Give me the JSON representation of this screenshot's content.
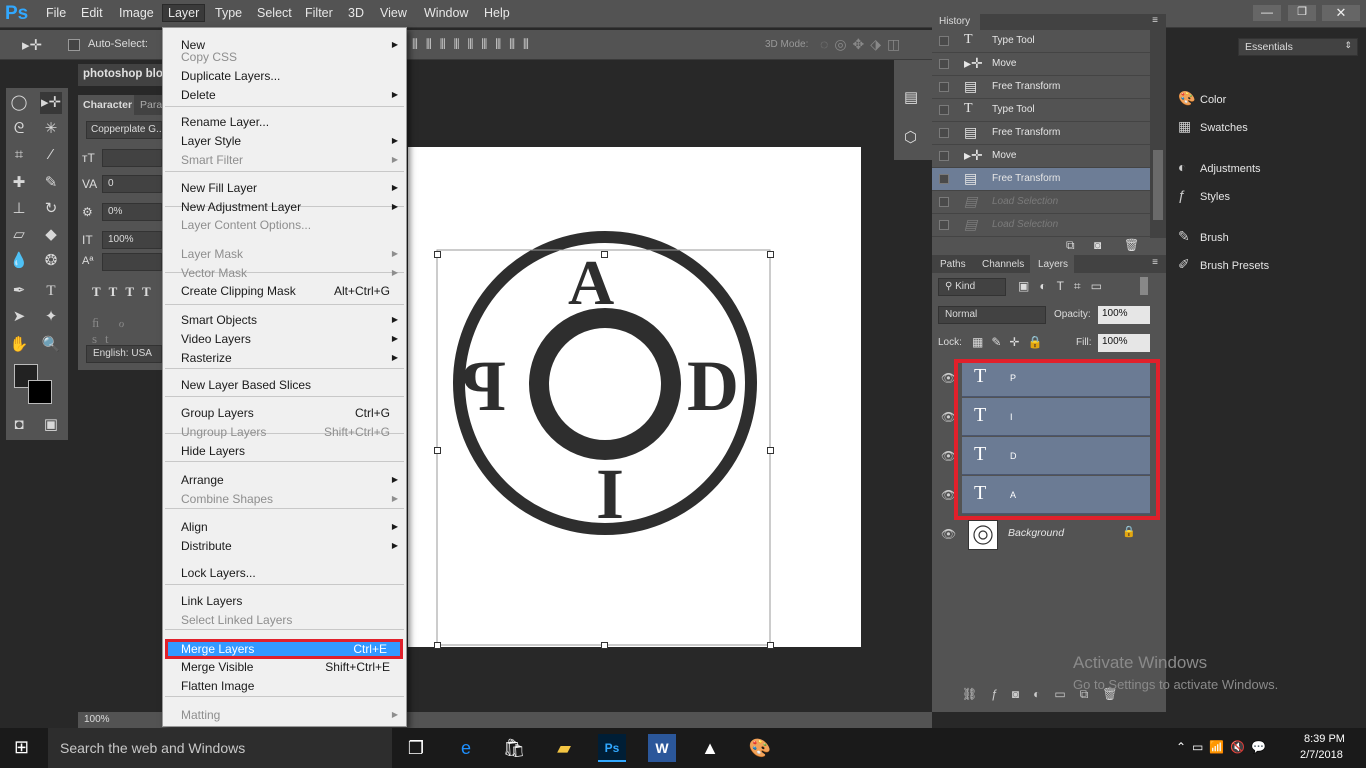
{
  "app": {
    "logo": "Ps"
  },
  "menubar": {
    "items": [
      "File",
      "Edit",
      "Image",
      "Layer",
      "Type",
      "Select",
      "Filter",
      "3D",
      "View",
      "Window",
      "Help"
    ],
    "active": "Layer"
  },
  "options": {
    "auto_select": "Auto-Select:",
    "mode3d": "3D Mode:",
    "workspace": "Essentials"
  },
  "document": {
    "tab_title": "photoshop blo",
    "zoom": "100%"
  },
  "character": {
    "tabs": [
      "Character",
      "Para"
    ],
    "font": "Copperplate G...",
    "tracking": "0",
    "scale": "0%",
    "scale_v": "100%",
    "language": "English: USA"
  },
  "layer_menu": {
    "items": [
      {
        "label": "New",
        "shortcut": "",
        "sub": true,
        "disabled": false
      },
      {
        "label": "Copy CSS",
        "shortcut": "",
        "sub": false,
        "disabled": true
      },
      {
        "label": "Duplicate Layers...",
        "shortcut": "",
        "sub": false,
        "disabled": false
      },
      {
        "label": "Delete",
        "shortcut": "",
        "sub": true,
        "disabled": false
      },
      {
        "label": "Rename Layer...",
        "shortcut": "",
        "sub": false,
        "disabled": false
      },
      {
        "label": "Layer Style",
        "shortcut": "",
        "sub": true,
        "disabled": false
      },
      {
        "label": "Smart Filter",
        "shortcut": "",
        "sub": true,
        "disabled": true
      },
      {
        "label": "New Fill Layer",
        "shortcut": "",
        "sub": true,
        "disabled": false
      },
      {
        "label": "New Adjustment Layer",
        "shortcut": "",
        "sub": true,
        "disabled": false
      },
      {
        "label": "Layer Content Options...",
        "shortcut": "",
        "sub": false,
        "disabled": true
      },
      {
        "label": "Layer Mask",
        "shortcut": "",
        "sub": true,
        "disabled": true
      },
      {
        "label": "Vector Mask",
        "shortcut": "",
        "sub": true,
        "disabled": true
      },
      {
        "label": "Create Clipping Mask",
        "shortcut": "Alt+Ctrl+G",
        "sub": false,
        "disabled": false
      },
      {
        "label": "Smart Objects",
        "shortcut": "",
        "sub": true,
        "disabled": false
      },
      {
        "label": "Video Layers",
        "shortcut": "",
        "sub": true,
        "disabled": false
      },
      {
        "label": "Rasterize",
        "shortcut": "",
        "sub": true,
        "disabled": false
      },
      {
        "label": "New Layer Based Slices",
        "shortcut": "",
        "sub": false,
        "disabled": false
      },
      {
        "label": "Group Layers",
        "shortcut": "Ctrl+G",
        "sub": false,
        "disabled": false
      },
      {
        "label": "Ungroup Layers",
        "shortcut": "Shift+Ctrl+G",
        "sub": false,
        "disabled": true
      },
      {
        "label": "Hide Layers",
        "shortcut": "",
        "sub": false,
        "disabled": false
      },
      {
        "label": "Arrange",
        "shortcut": "",
        "sub": true,
        "disabled": false
      },
      {
        "label": "Combine Shapes",
        "shortcut": "",
        "sub": true,
        "disabled": true
      },
      {
        "label": "Align",
        "shortcut": "",
        "sub": true,
        "disabled": false
      },
      {
        "label": "Distribute",
        "shortcut": "",
        "sub": true,
        "disabled": false
      },
      {
        "label": "Lock Layers...",
        "shortcut": "",
        "sub": false,
        "disabled": false
      },
      {
        "label": "Link Layers",
        "shortcut": "",
        "sub": false,
        "disabled": false
      },
      {
        "label": "Select Linked Layers",
        "shortcut": "",
        "sub": false,
        "disabled": true
      },
      {
        "label": "Merge Layers",
        "shortcut": "Ctrl+E",
        "sub": false,
        "disabled": false
      },
      {
        "label": "Merge Visible",
        "shortcut": "Shift+Ctrl+E",
        "sub": false,
        "disabled": false
      },
      {
        "label": "Flatten Image",
        "shortcut": "",
        "sub": false,
        "disabled": false
      },
      {
        "label": "Matting",
        "shortcut": "",
        "sub": true,
        "disabled": true
      }
    ]
  },
  "history": {
    "title": "History",
    "rows": [
      {
        "label": "Type Tool",
        "icon": "type-icon"
      },
      {
        "label": "Move",
        "icon": "move-icon"
      },
      {
        "label": "Free Transform",
        "icon": "document-icon"
      },
      {
        "label": "Type Tool",
        "icon": "type-icon"
      },
      {
        "label": "Free Transform",
        "icon": "document-icon"
      },
      {
        "label": "Move",
        "icon": "move-icon"
      },
      {
        "label": "Free Transform",
        "icon": "document-icon"
      },
      {
        "label": "Load Selection",
        "icon": "document-icon"
      },
      {
        "label": "Load Selection",
        "icon": "document-icon"
      }
    ]
  },
  "layers_panel": {
    "tabs": [
      "Paths",
      "Channels",
      "Layers"
    ],
    "kind": "Kind",
    "blend": "Normal",
    "opacity_label": "Opacity:",
    "opacity": "100%",
    "lock_label": "Lock:",
    "fill_label": "Fill:",
    "fill": "100%",
    "layers": [
      {
        "name": "P",
        "type": "text"
      },
      {
        "name": "I",
        "type": "text"
      },
      {
        "name": "D",
        "type": "text"
      },
      {
        "name": "A",
        "type": "text"
      },
      {
        "name": "Background",
        "type": "image"
      }
    ]
  },
  "right_dock": {
    "items": [
      "Color",
      "Swatches",
      "Adjustments",
      "Styles",
      "Brush",
      "Brush Presets"
    ]
  },
  "canvas_letters": {
    "top": "A",
    "left": "P",
    "right": "D",
    "bottom": "I"
  },
  "watermark": {
    "line1": "Activate Windows",
    "line2": "Go to Settings to activate Windows."
  },
  "taskbar": {
    "search": "Search the web and Windows",
    "time": "8:39 PM",
    "date": "2/7/2018"
  }
}
